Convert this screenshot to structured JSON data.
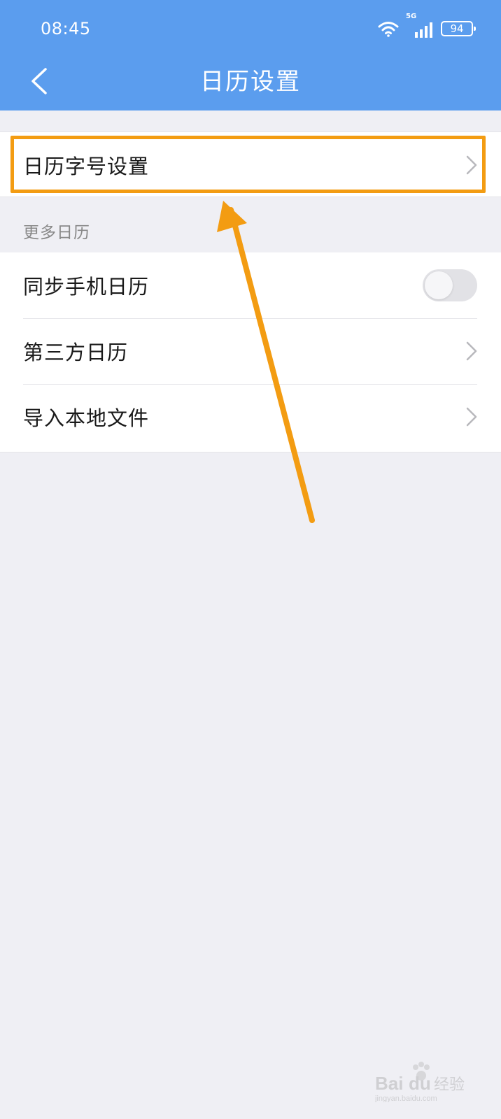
{
  "status_bar": {
    "time": "08:45",
    "network_type": "5G",
    "battery_level": "94",
    "icons": [
      "wifi-icon",
      "signal-icon",
      "battery-icon"
    ]
  },
  "header": {
    "title": "日历设置",
    "back_icon": "chevron-left-icon"
  },
  "settings": {
    "font_size_row": {
      "label": "日历字号设置",
      "icon": "chevron-right-icon"
    },
    "more_calendars": {
      "section_label": "更多日历",
      "items": [
        {
          "label": "同步手机日历",
          "control": "toggle",
          "on": false
        },
        {
          "label": "第三方日历",
          "icon": "chevron-right-icon"
        },
        {
          "label": "导入本地文件",
          "icon": "chevron-right-icon"
        }
      ]
    }
  },
  "colors": {
    "header_bg": "#5b9dee",
    "page_bg": "#efeff4",
    "annotation": "#f39c12",
    "toggle_off": "#e2e2e6"
  }
}
